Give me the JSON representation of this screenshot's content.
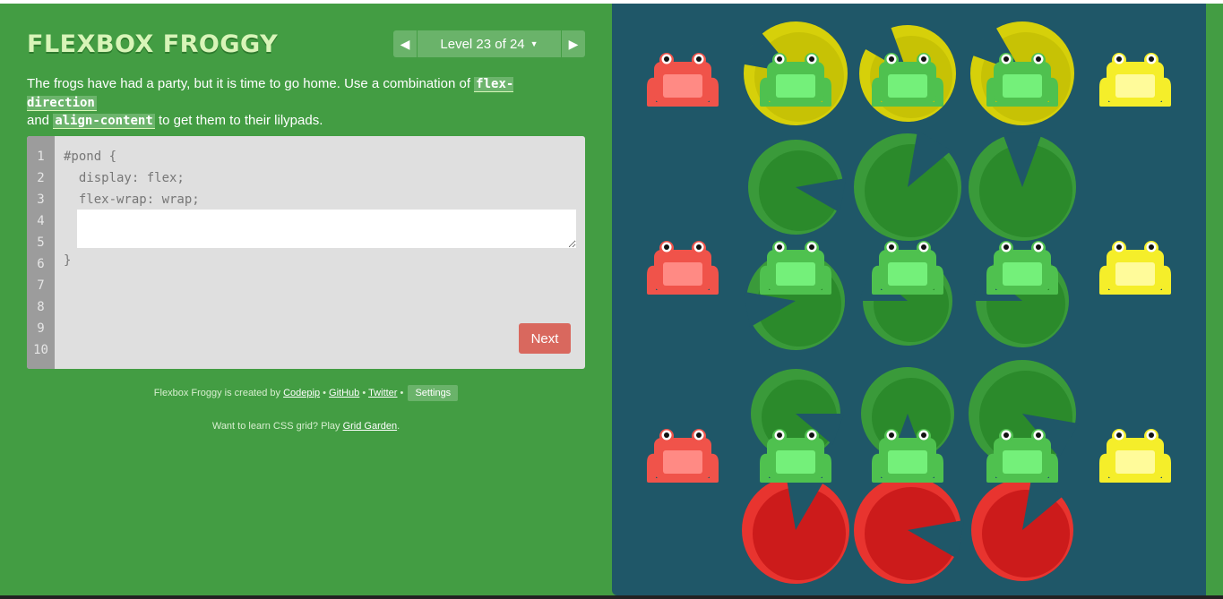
{
  "app": {
    "title": "FLEXBOX FROGGY"
  },
  "level_nav": {
    "label": "Level 23 of 24",
    "prev_icon": "triangle-left-icon",
    "next_icon": "triangle-right-icon",
    "caret_icon": "caret-down-icon"
  },
  "instructions": {
    "part1": "The frogs have had a party, but it is time to go home. Use a combination of ",
    "keyword1": "flex-direction",
    "part2": " and ",
    "keyword2": "align-content",
    "part3": " to get them to their lilypads."
  },
  "editor": {
    "line_numbers": [
      "1",
      "2",
      "3",
      "4",
      "5",
      "6",
      "7",
      "8",
      "9",
      "10"
    ],
    "line1": "#pond {",
    "line2": "  display: flex;",
    "line3": "  flex-wrap: wrap;",
    "answer_value": "",
    "close_brace": "}",
    "next_label": "Next"
  },
  "footer": {
    "created_by": "Flexbox Froggy is created by ",
    "codepip": "Codepip",
    "sep1": " • ",
    "github": "GitHub",
    "sep2": " • ",
    "twitter": "Twitter",
    "sep3": " • ",
    "settings": "Settings"
  },
  "footer2": {
    "prefix": "Want to learn CSS grid? Play ",
    "grid_garden": "Grid Garden",
    "suffix": "."
  },
  "pond": {
    "colors": {
      "background": "#1f5768",
      "red": "#e8342f",
      "green": "#2e8b2e",
      "yellow": "#d6d00a"
    },
    "frog_rows": [
      [
        "red",
        "green",
        "green",
        "green",
        "yellow"
      ],
      [
        "red",
        "green",
        "green",
        "green",
        "yellow"
      ],
      [
        "red",
        "green",
        "green",
        "green",
        "yellow"
      ]
    ],
    "lilypad_rows": [
      [
        "yellow",
        "yellow",
        "yellow"
      ],
      [
        "green",
        "green",
        "green"
      ],
      [
        "green",
        "green",
        "green"
      ],
      [
        "green",
        "green",
        "green"
      ],
      [
        "red",
        "red",
        "red"
      ]
    ]
  }
}
